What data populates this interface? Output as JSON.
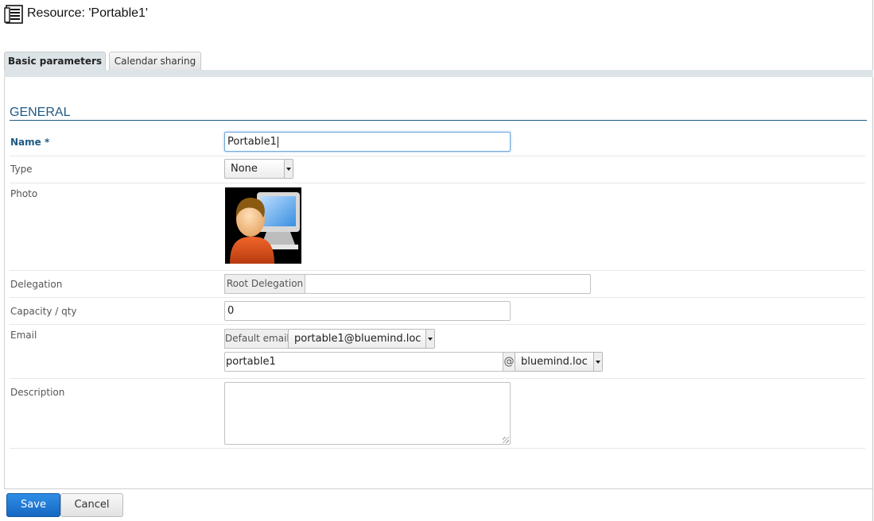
{
  "page": {
    "title": "Resource: 'Portable1'",
    "icon": "resource-list-icon"
  },
  "tabs": [
    {
      "label": "Basic parameters",
      "active": true
    },
    {
      "label": "Calendar sharing",
      "active": false
    }
  ],
  "section": {
    "title": "GENERAL"
  },
  "form": {
    "name": {
      "label": "Name *",
      "value": "Portable1"
    },
    "type": {
      "label": "Type",
      "selected": "None"
    },
    "photo": {
      "label": "Photo",
      "icon": "user-computer-icon"
    },
    "delegation": {
      "label": "Delegation",
      "addon": "Root Delegation",
      "value": ""
    },
    "capacity": {
      "label": "Capacity / qty",
      "value": "0"
    },
    "email": {
      "label": "Email",
      "addon": "Default email",
      "selected": "portable1@bluemind.loc",
      "local_part": "portable1",
      "at": "@",
      "domain": "bluemind.loc"
    },
    "description": {
      "label": "Description",
      "value": ""
    }
  },
  "actions": {
    "save": "Save",
    "cancel": "Cancel"
  },
  "colors": {
    "accent": "#1f5a85",
    "save_button": "#1a75d2",
    "tab_bar": "#dde4e8"
  }
}
